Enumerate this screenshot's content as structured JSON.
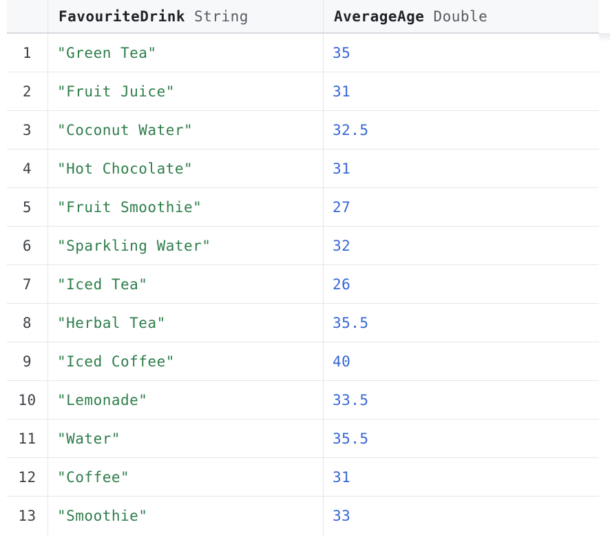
{
  "columns": [
    {
      "name": "FavouriteDrink",
      "type": "String"
    },
    {
      "name": "AverageAge",
      "type": "Double"
    }
  ],
  "rows": [
    {
      "index": "1",
      "drink": "\"Green Tea\"",
      "age": "35"
    },
    {
      "index": "2",
      "drink": "\"Fruit Juice\"",
      "age": "31"
    },
    {
      "index": "3",
      "drink": "\"Coconut Water\"",
      "age": "32.5"
    },
    {
      "index": "4",
      "drink": "\"Hot Chocolate\"",
      "age": "31"
    },
    {
      "index": "5",
      "drink": "\"Fruit Smoothie\"",
      "age": "27"
    },
    {
      "index": "6",
      "drink": "\"Sparkling Water\"",
      "age": "32"
    },
    {
      "index": "7",
      "drink": "\"Iced Tea\"",
      "age": "26"
    },
    {
      "index": "8",
      "drink": "\"Herbal Tea\"",
      "age": "35.5"
    },
    {
      "index": "9",
      "drink": "\"Iced Coffee\"",
      "age": "40"
    },
    {
      "index": "10",
      "drink": "\"Lemonade\"",
      "age": "33.5"
    },
    {
      "index": "11",
      "drink": "\"Water\"",
      "age": "35.5"
    },
    {
      "index": "12",
      "drink": "\"Coffee\"",
      "age": "31"
    },
    {
      "index": "13",
      "drink": "\"Smoothie\"",
      "age": "33"
    }
  ],
  "colors": {
    "string_value": "#2e7d4a",
    "number_value": "#3565d6",
    "header_background": "#f7f8fa"
  }
}
